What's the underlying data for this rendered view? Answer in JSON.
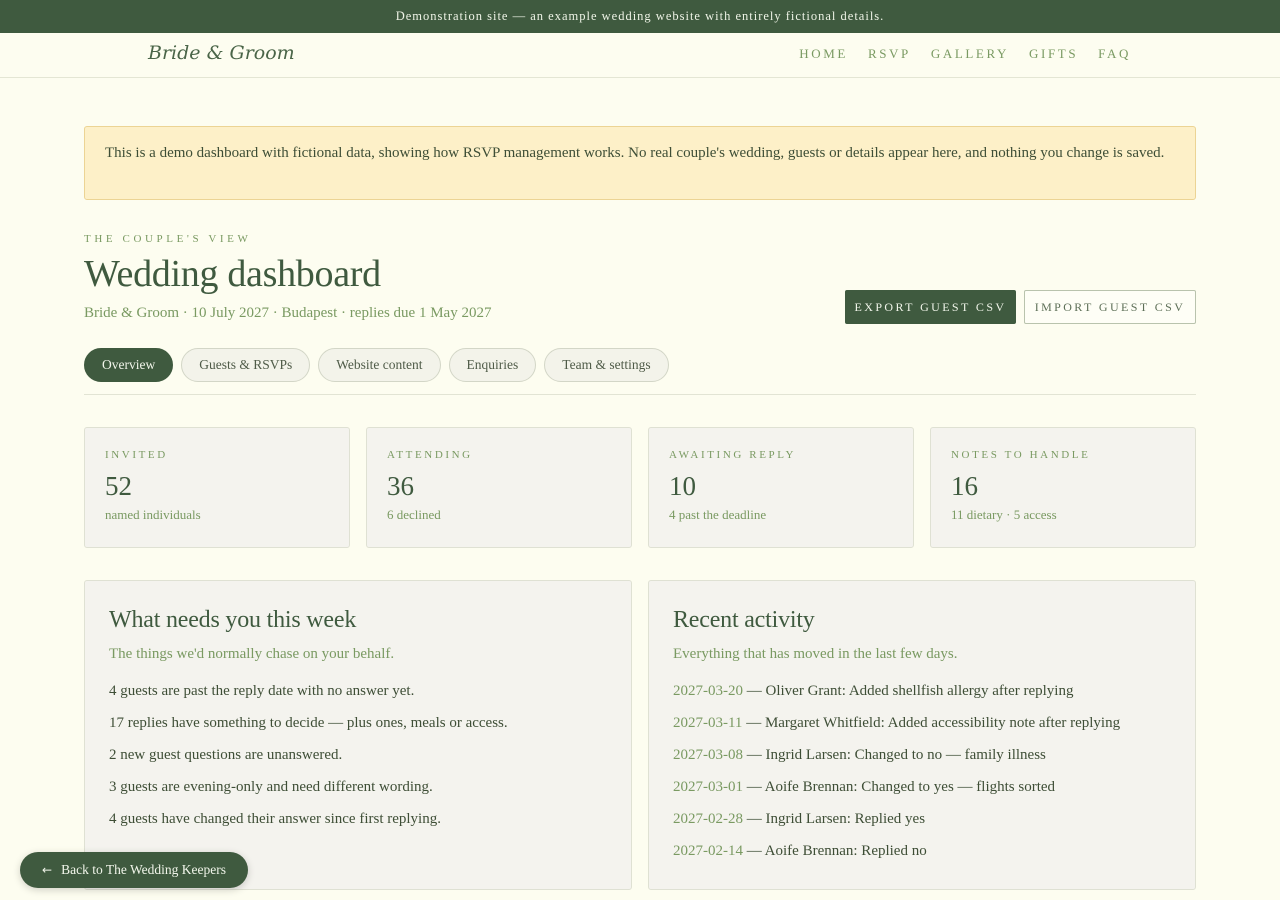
{
  "topbar": {
    "text": "Demonstration site — an example wedding website with entirely fictional details."
  },
  "nav": {
    "brand": "Bride & Groom",
    "links": [
      "HOME",
      "RSVP",
      "GALLERY",
      "GIFTS",
      "FAQ"
    ]
  },
  "notice": {
    "text": "This is a demo dashboard with fictional data, showing how RSVP management works. No real couple's wedding, guests or details appear here, and nothing you change is saved."
  },
  "header": {
    "eyebrow": "THE COUPLE'S VIEW",
    "title": "Wedding dashboard",
    "subtitle": "Bride & Groom · 10 July 2027 · Budapest · replies due 1 May 2027",
    "export_label": "EXPORT GUEST CSV",
    "import_label": "IMPORT GUEST CSV"
  },
  "tabs": [
    {
      "label": "Overview",
      "active": true
    },
    {
      "label": "Guests & RSVPs",
      "active": false
    },
    {
      "label": "Website content",
      "active": false
    },
    {
      "label": "Enquiries",
      "active": false
    },
    {
      "label": "Team & settings",
      "active": false
    }
  ],
  "stats": [
    {
      "label": "INVITED",
      "value": "52",
      "sub": "named individuals"
    },
    {
      "label": "ATTENDING",
      "value": "36",
      "sub": "6 declined"
    },
    {
      "label": "AWAITING REPLY",
      "value": "10",
      "sub": "4 past the deadline"
    },
    {
      "label": "NOTES TO HANDLE",
      "value": "16",
      "sub": "11 dietary · 5 access"
    }
  ],
  "week_panel": {
    "title": "What needs you this week",
    "subtitle": "The things we'd normally chase on your behalf.",
    "items": [
      "4 guests are past the reply date with no answer yet.",
      "17 replies have something to decide — plus ones, meals or access.",
      "2 new guest questions are unanswered.",
      "3 guests are evening-only and need different wording.",
      "4 guests have changed their answer since first replying."
    ]
  },
  "activity_panel": {
    "title": "Recent activity",
    "subtitle": "Everything that has moved in the last few days.",
    "items": [
      {
        "date": "2027-03-20",
        "text": " — Oliver Grant: Added shellfish allergy after replying"
      },
      {
        "date": "2027-03-11",
        "text": " — Margaret Whitfield: Added accessibility note after replying"
      },
      {
        "date": "2027-03-08",
        "text": " — Ingrid Larsen: Changed to no — family illness"
      },
      {
        "date": "2027-03-01",
        "text": " — Aoife Brennan: Changed to yes — flights sorted"
      },
      {
        "date": "2027-02-28",
        "text": " — Ingrid Larsen: Replied yes"
      },
      {
        "date": "2027-02-14",
        "text": " — Aoife Brennan: Replied no"
      }
    ]
  },
  "back_button": {
    "arrow": "←",
    "label": "Back to The Wedding Keepers"
  }
}
